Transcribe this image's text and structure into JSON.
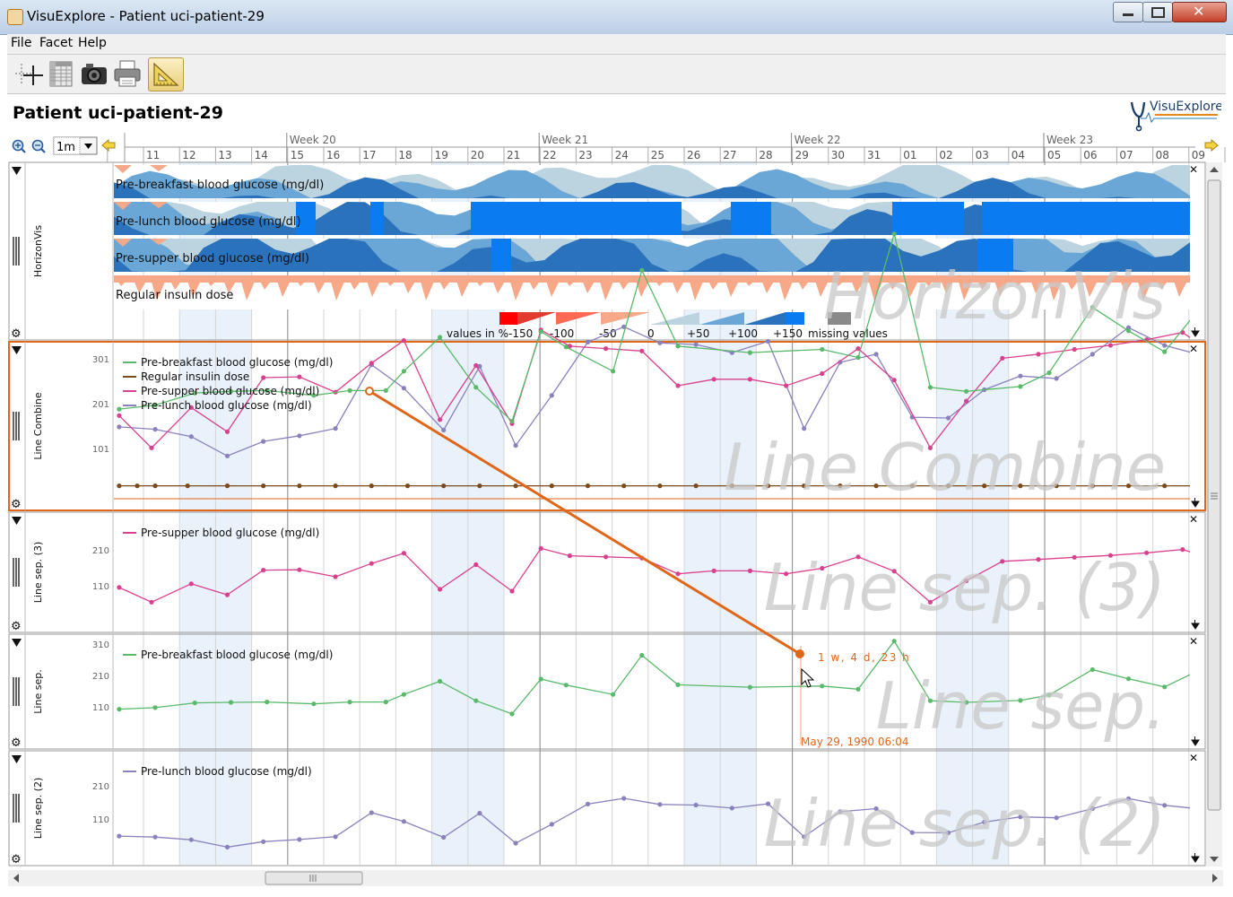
{
  "window": {
    "title": "VisuExplore - Patient uci-patient-29"
  },
  "menu": [
    "File",
    "Facet",
    "Help"
  ],
  "toolbar": {
    "tools": [
      "add-facet-icon",
      "table-icon",
      "camera-icon",
      "printer-icon",
      "ruler-icon"
    ]
  },
  "patient_title": "Patient uci-patient-29",
  "logo_text": "VisuExplore",
  "zoom_select": "1m",
  "timeline": {
    "weeks": [
      {
        "label": "Week 20",
        "day_index": 4
      },
      {
        "label": "Week 21",
        "day_index": 11
      },
      {
        "label": "Week 22",
        "day_index": 18
      },
      {
        "label": "Week 23",
        "day_index": 25
      }
    ],
    "days": [
      "11",
      "12",
      "13",
      "14",
      "15",
      "16",
      "17",
      "18",
      "19",
      "20",
      "21",
      "22",
      "23",
      "24",
      "25",
      "26",
      "27",
      "28",
      "29",
      "30",
      "31",
      "01",
      "02",
      "03",
      "04",
      "05",
      "06",
      "07",
      "08",
      "09"
    ]
  },
  "panels": {
    "horizon": {
      "label": "HorizonVis",
      "watermark": "HorizonVis",
      "rows": [
        "Pre-breakfast blood glucose (mg/dl)",
        "Pre-lunch blood glucose (mg/dl)",
        "Pre-supper blood glucose (mg/dl)",
        "Regular insulin dose"
      ],
      "legend": {
        "prefix": "values in %",
        "ticks": [
          "-150",
          "-100",
          "-50",
          "0",
          "+50",
          "+100",
          "+150"
        ],
        "missing": "missing values"
      }
    },
    "combine": {
      "label": "Line Combine",
      "watermark": "Line Combine",
      "yticks": [
        "301",
        "201",
        "101"
      ],
      "legend": [
        "Pre-breakfast blood glucose (mg/dl)",
        "Regular insulin dose",
        "Pre-supper blood glucose (mg/dl)",
        "Pre-lunch blood glucose (mg/dl)"
      ]
    },
    "sep3": {
      "label": "Line sep. (3)",
      "watermark": "Line sep. (3)",
      "yticks": [
        "210",
        "110"
      ],
      "legend": "Pre-supper blood glucose (mg/dl)"
    },
    "sep": {
      "label": "Line sep.",
      "watermark": "Line sep.",
      "yticks": [
        "310",
        "210",
        "110"
      ],
      "legend": "Pre-breakfast blood glucose (mg/dl)"
    },
    "sep2": {
      "label": "Line sep. (2)",
      "watermark": "Line sep. (2)",
      "yticks": [
        "210",
        "110"
      ],
      "legend": "Pre-lunch blood glucose (mg/dl)"
    }
  },
  "measure": {
    "duration": "1 w, 4 d, 23 h",
    "cursor_time": "May 29, 1990 06:04"
  },
  "colors": {
    "pre_breakfast": "#5ab96a",
    "insulin": "#7b4a1d",
    "pre_supper": "#d9418f",
    "pre_lunch": "#8a82bd",
    "measure": "#e0661a"
  },
  "chart_data": [
    {
      "type": "line",
      "title": "Line Combine",
      "x": "day index (0 = 11th)",
      "series": [
        {
          "name": "Pre-breakfast blood glucose (mg/dl)",
          "points": [
            [
              -0.7,
              101
            ],
            [
              0.3,
              106
            ],
            [
              1.4,
              121
            ],
            [
              2.4,
              123
            ],
            [
              3.4,
              124
            ],
            [
              4.7,
              118
            ],
            [
              5.7,
              124
            ],
            [
              6.7,
              124
            ],
            [
              7.2,
              148
            ],
            [
              8.2,
              190
            ],
            [
              9.2,
              128
            ],
            [
              10.2,
              86
            ],
            [
              11,
              197
            ],
            [
              11.7,
              178
            ],
            [
              13,
              148
            ],
            [
              13.8,
              273
            ],
            [
              14.8,
              179
            ],
            [
              16.8,
              171
            ],
            [
              18.8,
              175
            ],
            [
              19.8,
              165
            ],
            [
              20.8,
              318
            ],
            [
              21.8,
              128
            ],
            [
              22.8,
              123
            ],
            [
              24.3,
              129
            ],
            [
              25.1,
              146
            ],
            [
              26.3,
              227
            ],
            [
              27.3,
              198
            ],
            [
              28.3,
              172
            ],
            [
              29.3,
              227
            ],
            [
              30.3,
              227
            ],
            [
              31.3,
              217
            ],
            [
              32.3,
              196
            ],
            [
              33.3,
              173
            ]
          ]
        },
        {
          "name": "Regular insulin dose",
          "points": [
            [
              -0.7,
              6
            ],
            [
              -0.2,
              6
            ],
            [
              0.3,
              6
            ],
            [
              1.2,
              6
            ],
            [
              2.3,
              6
            ],
            [
              3.3,
              6
            ],
            [
              4.3,
              6
            ],
            [
              5.3,
              6
            ],
            [
              6.3,
              6
            ],
            [
              7.3,
              6
            ],
            [
              8.3,
              6
            ],
            [
              9.3,
              6
            ],
            [
              10.3,
              6
            ],
            [
              11.3,
              6
            ],
            [
              12.3,
              6
            ],
            [
              13.3,
              6
            ],
            [
              14.3,
              6
            ],
            [
              15.3,
              6
            ],
            [
              16.3,
              6
            ],
            [
              17.3,
              6
            ],
            [
              18.3,
              6
            ],
            [
              19.3,
              6
            ],
            [
              20.3,
              6
            ],
            [
              21.3,
              6
            ],
            [
              22.3,
              6
            ],
            [
              23.3,
              6
            ],
            [
              24.3,
              6
            ],
            [
              25.3,
              6
            ],
            [
              26.3,
              6
            ],
            [
              27.3,
              6
            ],
            [
              28.3,
              6
            ],
            [
              29.3,
              6
            ],
            [
              30.3,
              6
            ],
            [
              31.3,
              6
            ],
            [
              32.3,
              6
            ],
            [
              33.3,
              6
            ]
          ]
        },
        {
          "name": "Pre-supper blood glucose (mg/dl)",
          "points": [
            [
              -0.7,
              93
            ],
            [
              0.2,
              53
            ],
            [
              1.3,
              103
            ],
            [
              2.3,
              73
            ],
            [
              3.3,
              140
            ],
            [
              4.3,
              141
            ],
            [
              5.3,
              122
            ],
            [
              6.3,
              158
            ],
            [
              7.2,
              186
            ],
            [
              8.2,
              88
            ],
            [
              9.2,
              155
            ],
            [
              10.2,
              83
            ],
            [
              11,
              199
            ],
            [
              11.8,
              179
            ],
            [
              12.8,
              176
            ],
            [
              13.8,
              173
            ],
            [
              14.8,
              130
            ],
            [
              15.8,
              138
            ],
            [
              16.8,
              138
            ],
            [
              17.8,
              130
            ],
            [
              18.8,
              145
            ],
            [
              19.8,
              176
            ],
            [
              20.8,
              137
            ],
            [
              21.8,
              53
            ],
            [
              22.8,
              111
            ],
            [
              23.8,
              164
            ],
            [
              24.8,
              169
            ],
            [
              25.8,
              175
            ],
            [
              26.8,
              180
            ],
            [
              27.8,
              187
            ],
            [
              28.8,
              196
            ],
            [
              29.8,
              165
            ],
            [
              30.8,
              154
            ],
            [
              31.8,
              178
            ],
            [
              32.8,
              172
            ],
            [
              33.8,
              143
            ]
          ]
        },
        {
          "name": "Pre-lunch blood glucose (mg/dl)",
          "points": [
            [
              -0.7,
              79
            ],
            [
              0.3,
              76
            ],
            [
              1.3,
              67
            ],
            [
              2.3,
              43
            ],
            [
              3.3,
              61
            ],
            [
              4.3,
              68
            ],
            [
              5.3,
              77
            ],
            [
              6.3,
              156
            ],
            [
              7.2,
              127
            ],
            [
              8.3,
              75
            ],
            [
              9.3,
              154
            ],
            [
              10.3,
              56
            ],
            [
              11.3,
              118
            ],
            [
              12.3,
              184
            ],
            [
              13.3,
              203
            ],
            [
              14.3,
              183
            ],
            [
              15.3,
              181
            ],
            [
              16.3,
              171
            ],
            [
              17.3,
              185
            ],
            [
              18.3,
              77
            ],
            [
              19.3,
              159
            ],
            [
              20.3,
              169
            ],
            [
              21.3,
              91
            ],
            [
              22.3,
              90
            ],
            [
              23.3,
              125
            ],
            [
              24.3,
              142
            ],
            [
              25.3,
              139
            ],
            [
              26.3,
              169
            ],
            [
              27.3,
              202
            ],
            [
              28.3,
              180
            ],
            [
              29.3,
              168
            ],
            [
              30.3,
              215
            ],
            [
              31.3,
              201
            ],
            [
              32.3,
              193
            ],
            [
              33.3,
              193
            ]
          ]
        }
      ]
    },
    {
      "type": "line",
      "title": "Line sep. (3)",
      "series": [
        {
          "name": "Pre-supper blood glucose (mg/dl)"
        }
      ]
    },
    {
      "type": "line",
      "title": "Line sep.",
      "series": [
        {
          "name": "Pre-breakfast blood glucose (mg/dl)"
        }
      ]
    },
    {
      "type": "line",
      "title": "Line sep. (2)",
      "series": [
        {
          "name": "Pre-lunch blood glucose (mg/dl)"
        }
      ]
    }
  ]
}
